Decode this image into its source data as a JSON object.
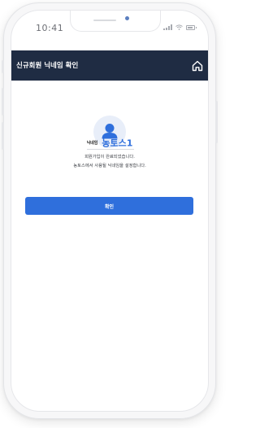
{
  "status_bar": {
    "time": "10:41",
    "icons": [
      "signal-icon",
      "wifi-icon",
      "battery-icon"
    ]
  },
  "header": {
    "title": "신규회원 닉네임 확인",
    "home_icon": "home-icon",
    "background": "#1f2c43"
  },
  "profile": {
    "avatar_icon": "user-icon",
    "nickname_label": "닉네임",
    "nickname_value": "농토스1"
  },
  "messages": {
    "line1": "회원가입이 완료되었습니다.",
    "line2": "농토스에서 사용될 닉네임을 설정합니다."
  },
  "confirm_button": {
    "label": "확인",
    "color": "#2f6fdc"
  }
}
